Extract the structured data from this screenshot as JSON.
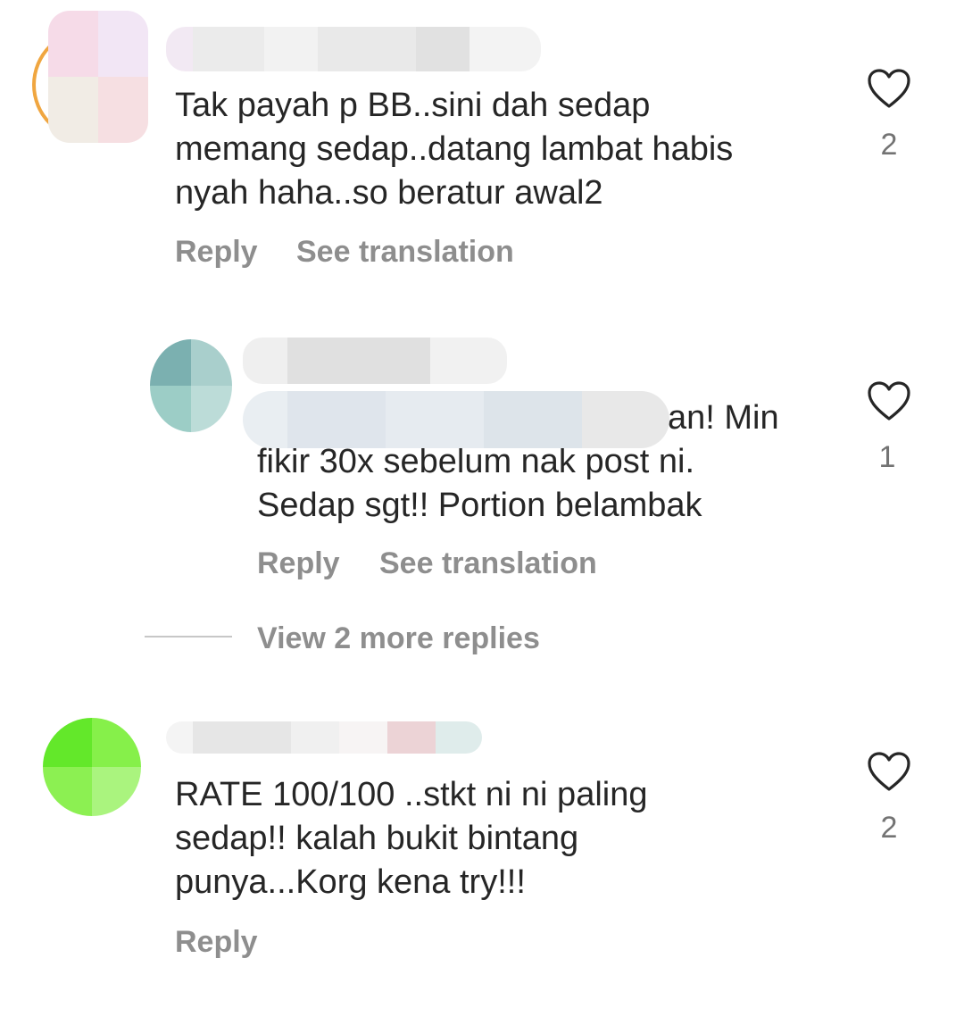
{
  "comments": [
    {
      "text": "Tak payah p BB..sini dah sedap\nmemang sedap..datang lambat habis\nnyah haha..so beratur awal2",
      "reply_label": "Reply",
      "translate_label": "See translation",
      "like_count": "2"
    },
    {
      "text": "an! Min\nfikir 30x sebelum nak post ni.\nSedap sgt!! Portion belambak",
      "reply_label": "Reply",
      "translate_label": "See translation",
      "like_count": "1"
    },
    {
      "text": "RATE 100/100 ..stkt ni ni paling\nsedap!! kalah bukit bintang\npunya...Korg kena try!!!",
      "reply_label": "Reply",
      "like_count": "2"
    }
  ],
  "view_more_replies": "View 2 more replies",
  "icons": {
    "like": "heart-outline-icon"
  },
  "colors": {
    "secondary_text": "#8e8e8e",
    "primary_text": "#262626"
  }
}
